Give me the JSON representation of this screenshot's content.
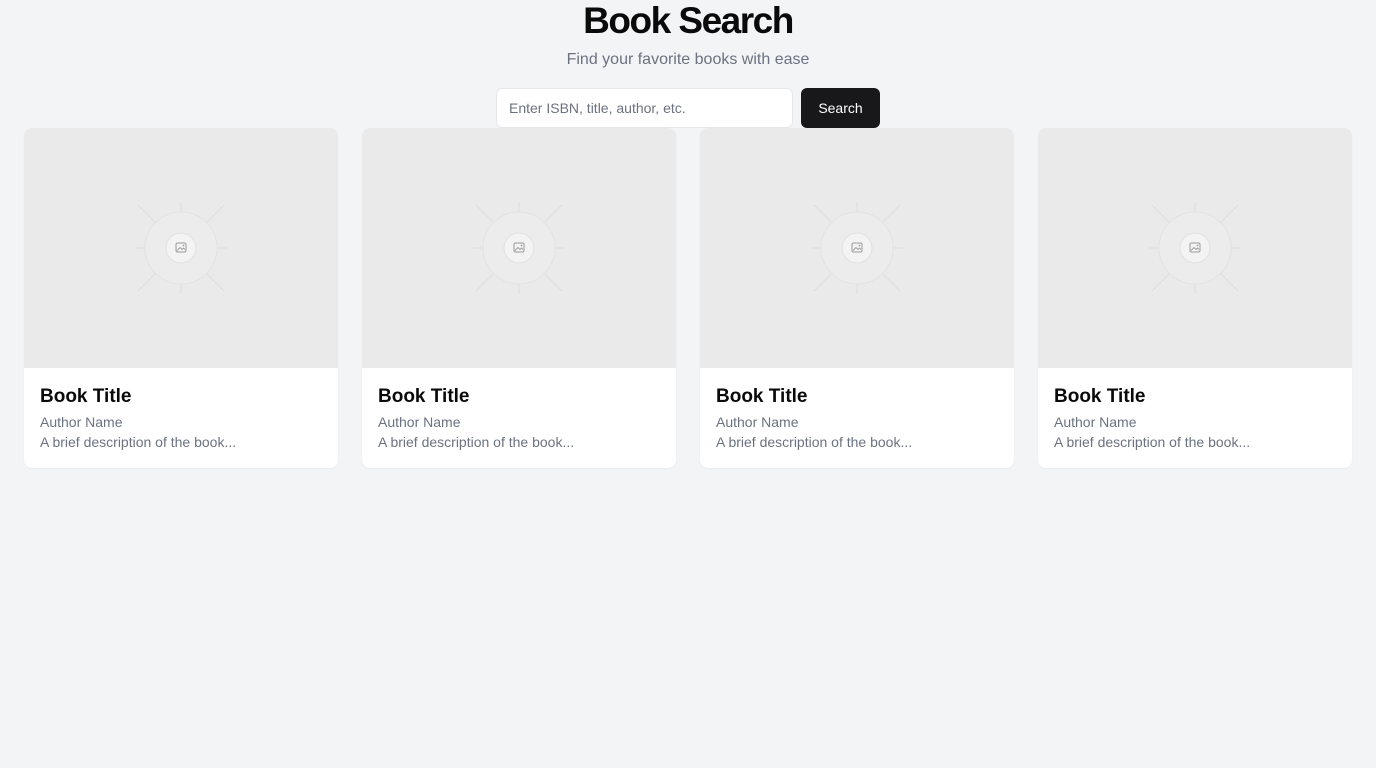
{
  "header": {
    "title": "Book Search",
    "subtitle": "Find your favorite books with ease"
  },
  "search": {
    "placeholder": "Enter ISBN, title, author, etc.",
    "value": "",
    "button_label": "Search"
  },
  "books": [
    {
      "title": "Book Title",
      "author": "Author Name",
      "description": "A brief description of the book...",
      "cover_icon": "image-placeholder-icon"
    },
    {
      "title": "Book Title",
      "author": "Author Name",
      "description": "A brief description of the book...",
      "cover_icon": "image-placeholder-icon"
    },
    {
      "title": "Book Title",
      "author": "Author Name",
      "description": "A brief description of the book...",
      "cover_icon": "image-placeholder-icon"
    },
    {
      "title": "Book Title",
      "author": "Author Name",
      "description": "A brief description of the book...",
      "cover_icon": "image-placeholder-icon"
    }
  ],
  "colors": {
    "background": "#f3f4f6",
    "button": "#18181b",
    "muted_text": "#6b7280",
    "cover_placeholder": "#eaeaea"
  }
}
